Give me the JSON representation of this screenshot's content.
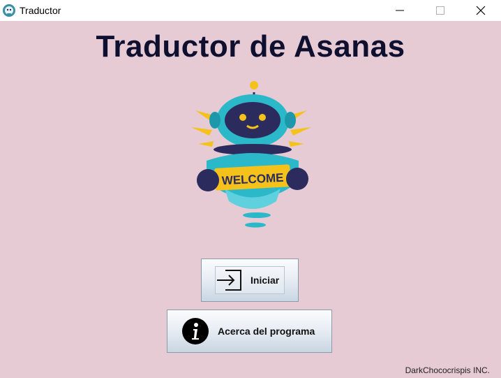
{
  "window": {
    "title": "Traductor",
    "controls": [
      "minimize-icon",
      "maximize-icon",
      "close-icon"
    ]
  },
  "main": {
    "heading": "Traductor de Asanas",
    "robot_sign": "WELCOME"
  },
  "buttons": {
    "start_label": "Iniciar",
    "about_label": "Acerca del programa"
  },
  "footer": {
    "credit": "DarkChococrispis INC."
  },
  "colors": {
    "background": "#e6cad4",
    "heading": "#0f1030",
    "robot_teal": "#2bb8c9",
    "robot_navy": "#2b2b5e",
    "sign_yellow": "#f4c21a"
  }
}
